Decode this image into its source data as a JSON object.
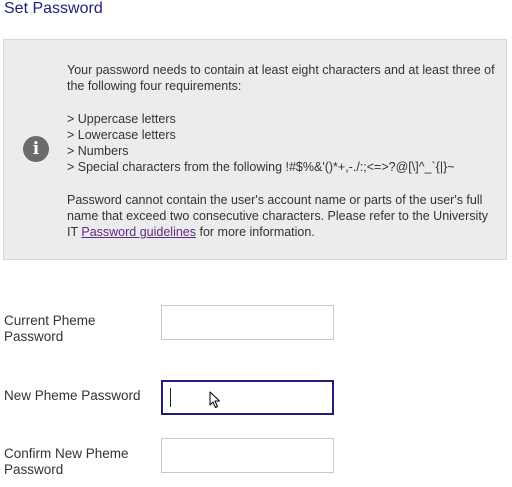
{
  "page": {
    "title": "Set Password"
  },
  "info": {
    "intro": "Your password needs to contain at least eight characters and at least three of the following four requirements:",
    "requirements": [
      "> Uppercase letters",
      "> Lowercase letters",
      "> Numbers",
      "> Special characters from the following !#$%&'()*+,-./:;<=>?@[\\]^_`{|}~"
    ],
    "policy_before_link": "Password cannot contain the user's account name or parts of the user's full name that exceed two consecutive characters. Please refer to the University IT ",
    "policy_link": "Password guidelines",
    "policy_after_link": " for more information.",
    "icon": "info-icon"
  },
  "form": {
    "current_password": {
      "label_line1": "Current Pheme",
      "label_line2": "Password",
      "value": ""
    },
    "new_password": {
      "label": "New Pheme Password",
      "value": ""
    },
    "confirm_password": {
      "label_line1": "Confirm New Pheme",
      "label_line2": "Password",
      "value": ""
    }
  },
  "colors": {
    "title": "#1f1f7a",
    "link": "#5a2d82",
    "info_background": "#ececec",
    "focus_border": "#1f1f7a"
  }
}
